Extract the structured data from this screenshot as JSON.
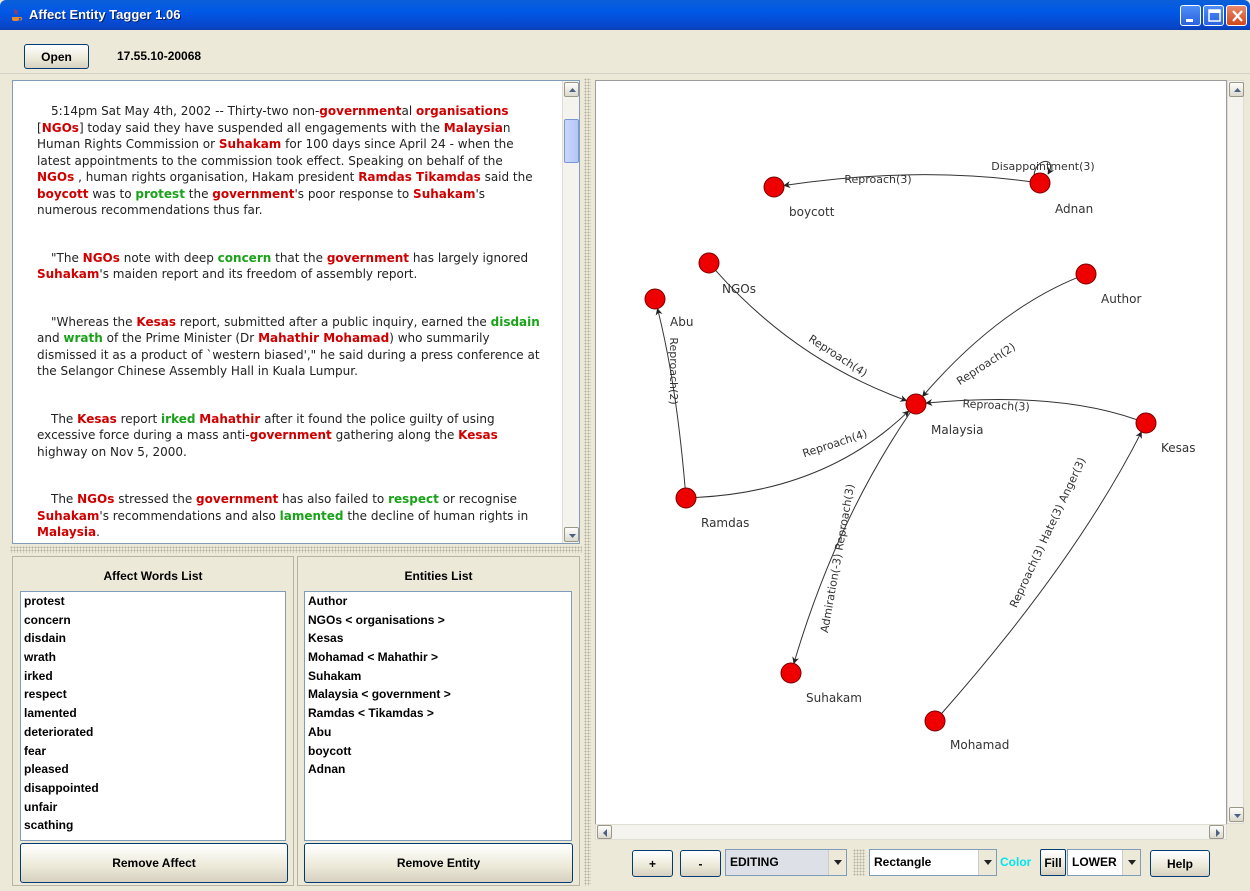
{
  "window": {
    "title": "Affect Entity Tagger 1.06"
  },
  "toolbar": {
    "open_label": "Open",
    "file_name": "17.55.10-20068"
  },
  "article": {
    "paragraphs": [
      [
        {
          "t": "5:14pm Sat May 4th, 2002 -- Thirty-two non-",
          "k": ""
        },
        {
          "t": "government",
          "k": "e"
        },
        {
          "t": "al ",
          "k": ""
        },
        {
          "t": "organisations",
          "k": "e"
        },
        {
          "t": " [",
          "k": ""
        },
        {
          "t": "NGOs",
          "k": "e"
        },
        {
          "t": "] today said they have suspended all engagements with the ",
          "k": ""
        },
        {
          "t": "Malaysia",
          "k": "e"
        },
        {
          "t": "n Human Rights Commission or ",
          "k": ""
        },
        {
          "t": "Suhakam",
          "k": "e"
        },
        {
          "t": " for 100 days since April 24 - when the latest appointments to the commission took effect. Speaking on behalf of the ",
          "k": ""
        },
        {
          "t": "NGOs",
          "k": "e"
        },
        {
          "t": " , human rights organisation, Hakam president ",
          "k": ""
        },
        {
          "t": "Ramdas Tikamdas",
          "k": "e"
        },
        {
          "t": " said the ",
          "k": ""
        },
        {
          "t": "boycott",
          "k": "e"
        },
        {
          "t": " was to ",
          "k": ""
        },
        {
          "t": "protest",
          "k": "a"
        },
        {
          "t": " the ",
          "k": ""
        },
        {
          "t": "government",
          "k": "e"
        },
        {
          "t": "'s poor response to ",
          "k": ""
        },
        {
          "t": "Suhakam",
          "k": "e"
        },
        {
          "t": "'s numerous recommendations thus far.",
          "k": ""
        }
      ],
      [
        {
          "t": "\"The ",
          "k": ""
        },
        {
          "t": "NGOs",
          "k": "e"
        },
        {
          "t": " note with deep ",
          "k": ""
        },
        {
          "t": "concern",
          "k": "a"
        },
        {
          "t": " that the ",
          "k": ""
        },
        {
          "t": "government",
          "k": "e"
        },
        {
          "t": " has largely ignored ",
          "k": ""
        },
        {
          "t": "Suhakam",
          "k": "e"
        },
        {
          "t": "'s maiden report and its freedom of assembly report.",
          "k": ""
        }
      ],
      [
        {
          "t": "\"Whereas the ",
          "k": ""
        },
        {
          "t": "Kesas",
          "k": "e"
        },
        {
          "t": " report, submitted after a public inquiry, earned the ",
          "k": ""
        },
        {
          "t": "disdain",
          "k": "a"
        },
        {
          "t": " and ",
          "k": ""
        },
        {
          "t": "wrath",
          "k": "a"
        },
        {
          "t": " of the Prime Minister (Dr ",
          "k": ""
        },
        {
          "t": "Mahathir Mohamad",
          "k": "e"
        },
        {
          "t": ") who summarily dismissed it as a product of `western biased',\" he said during a press conference at the Selangor Chinese Assembly Hall in Kuala Lumpur.",
          "k": ""
        }
      ],
      [
        {
          "t": "The ",
          "k": ""
        },
        {
          "t": "Kesas",
          "k": "e"
        },
        {
          "t": " report ",
          "k": ""
        },
        {
          "t": "irked",
          "k": "a"
        },
        {
          "t": " ",
          "k": ""
        },
        {
          "t": "Mahathir",
          "k": "e"
        },
        {
          "t": " after it found the police guilty of using excessive force during a mass anti-",
          "k": ""
        },
        {
          "t": "government",
          "k": "e"
        },
        {
          "t": " gathering along the ",
          "k": ""
        },
        {
          "t": "Kesas",
          "k": "e"
        },
        {
          "t": " highway on Nov 5, 2000.",
          "k": ""
        }
      ],
      [
        {
          "t": "The ",
          "k": ""
        },
        {
          "t": "NGOs",
          "k": "e"
        },
        {
          "t": " stressed the ",
          "k": ""
        },
        {
          "t": "government",
          "k": "e"
        },
        {
          "t": " has also failed to ",
          "k": ""
        },
        {
          "t": "respect",
          "k": "a"
        },
        {
          "t": " or recognise ",
          "k": ""
        },
        {
          "t": "Suhakam",
          "k": "e"
        },
        {
          "t": "'s recommendations and also ",
          "k": ""
        },
        {
          "t": "lamented",
          "k": "a"
        },
        {
          "t": " the decline of human rights in ",
          "k": ""
        },
        {
          "t": "Malaysia",
          "k": "e"
        },
        {
          "t": ".",
          "k": ""
        }
      ]
    ],
    "colors": {
      "entity": "#d00000",
      "affect": "#1aa31a"
    }
  },
  "affect_list": {
    "title": "Affect Words List",
    "items": [
      "protest",
      "concern",
      "disdain",
      "wrath",
      "irked",
      "respect",
      "lamented",
      "deteriorated",
      "fear",
      "pleased",
      "disappointed",
      "unfair",
      "scathing"
    ],
    "remove_label": "Remove Affect"
  },
  "entity_list": {
    "title": "Entities List",
    "items": [
      "Author",
      "NGOs < organisations >",
      "Kesas",
      "Mohamad < Mahathir >",
      "Suhakam",
      "Malaysia < government >",
      "Ramdas < Tikamdas >",
      "Abu",
      "boycott",
      "Adnan"
    ],
    "remove_label": "Remove Entity"
  },
  "graph": {
    "node_color": "#ee0000",
    "nodes": [
      {
        "id": "boycott",
        "label": "boycott"
      },
      {
        "id": "Adnan",
        "label": "Adnan"
      },
      {
        "id": "NGOs",
        "label": "NGOs"
      },
      {
        "id": "Abu",
        "label": "Abu"
      },
      {
        "id": "Author",
        "label": "Author"
      },
      {
        "id": "Malaysia",
        "label": "Malaysia"
      },
      {
        "id": "Kesas",
        "label": "Kesas"
      },
      {
        "id": "Ramdas",
        "label": "Ramdas"
      },
      {
        "id": "Suhakam",
        "label": "Suhakam"
      },
      {
        "id": "Mohamad",
        "label": "Mohamad"
      }
    ],
    "edges": [
      {
        "from": "Adnan",
        "to": "boycott",
        "label": "Reproach(3)"
      },
      {
        "from": "Adnan",
        "to": "Adnan",
        "label": "Disappointment(3)"
      },
      {
        "from": "NGOs",
        "to": "Malaysia",
        "label": "Reproach(4)"
      },
      {
        "from": "Author",
        "to": "Malaysia",
        "label": "Reproach(2)"
      },
      {
        "from": "Kesas",
        "to": "Malaysia",
        "label": "Reproach(3)"
      },
      {
        "from": "Ramdas",
        "to": "Malaysia",
        "label": "Reproach(4)"
      },
      {
        "from": "Ramdas",
        "to": "Abu",
        "label": "Reproach(2)"
      },
      {
        "from": "Malaysia",
        "to": "Suhakam",
        "label": "Admiration(-3) Reproach(3)"
      },
      {
        "from": "Mohamad",
        "to": "Kesas",
        "label": "Reproach(3) Hate(3) Anger(3)"
      }
    ]
  },
  "bottom_bar": {
    "plus_label": "+",
    "minus_label": "-",
    "mode_value": "EDITING",
    "shape_value": "Rectangle",
    "color_label": "Color",
    "color_value": "#00e5ee",
    "fill_label": "Fill",
    "layer_value": "LOWER",
    "help_label": "Help"
  }
}
